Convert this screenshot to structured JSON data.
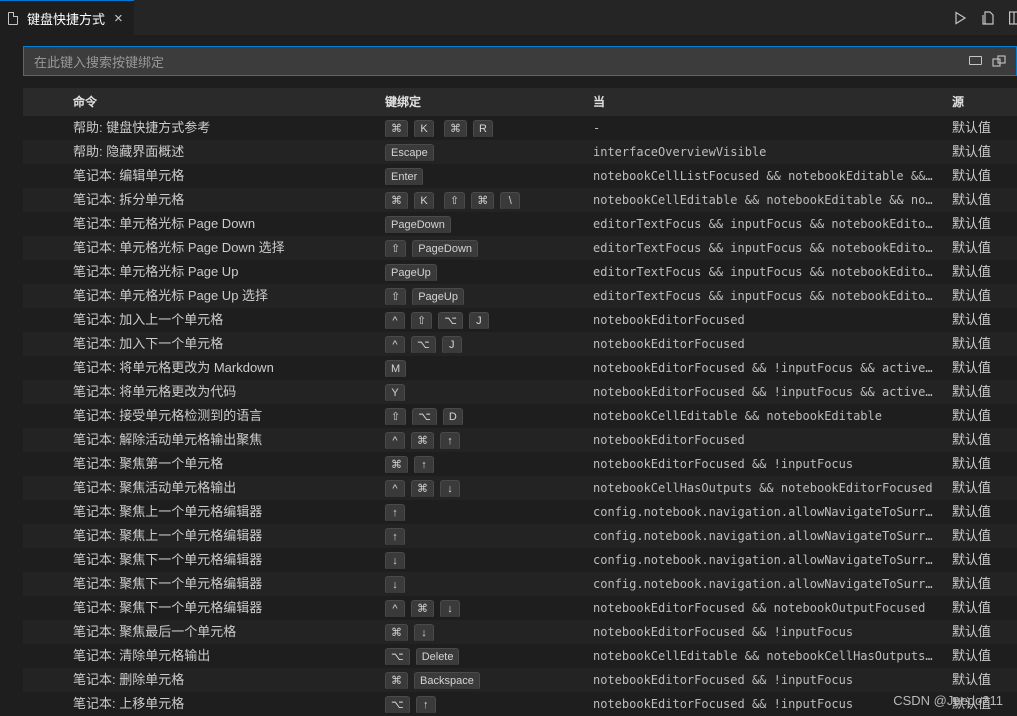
{
  "tab": {
    "title": "键盘快捷方式",
    "close": "×"
  },
  "search": {
    "placeholder": "在此键入搜索按键绑定"
  },
  "table": {
    "headers": {
      "command": "命令",
      "keybinding": "键绑定",
      "when": "当",
      "source": "源"
    },
    "rows": [
      {
        "command": "帮助: 键盘快捷方式参考",
        "keys": [
          [
            "⌘",
            "K"
          ],
          [
            "⌘",
            "R"
          ]
        ],
        "when": "-",
        "source": "默认值"
      },
      {
        "command": "帮助: 隐藏界面概述",
        "keys": [
          [
            "Escape"
          ]
        ],
        "when": "interfaceOverviewVisible",
        "source": "默认值"
      },
      {
        "command": "笔记本: 编辑单元格",
        "keys": [
          [
            "Enter"
          ]
        ],
        "when": "notebookCellListFocused && notebookEditable && !…",
        "source": "默认值"
      },
      {
        "command": "笔记本: 拆分单元格",
        "keys": [
          [
            "⌘",
            "K"
          ],
          [
            "⇧",
            "⌘",
            "\\"
          ]
        ],
        "when": "notebookCellEditable && notebookEditable && note…",
        "source": "默认值"
      },
      {
        "command": "笔记本: 单元格光标 Page Down",
        "keys": [
          [
            "PageDown"
          ]
        ],
        "when": "editorTextFocus && inputFocus && notebookEditorF…",
        "source": "默认值"
      },
      {
        "command": "笔记本: 单元格光标 Page Down 选择",
        "keys": [
          [
            "⇧",
            "PageDown"
          ]
        ],
        "when": "editorTextFocus && inputFocus && notebookEditorF…",
        "source": "默认值"
      },
      {
        "command": "笔记本: 单元格光标 Page Up",
        "keys": [
          [
            "PageUp"
          ]
        ],
        "when": "editorTextFocus && inputFocus && notebookEditorF…",
        "source": "默认值"
      },
      {
        "command": "笔记本: 单元格光标 Page Up 选择",
        "keys": [
          [
            "⇧",
            "PageUp"
          ]
        ],
        "when": "editorTextFocus && inputFocus && notebookEditorF…",
        "source": "默认值"
      },
      {
        "command": "笔记本: 加入上一个单元格",
        "keys": [
          [
            "^",
            "⇧",
            "⌥",
            "J"
          ]
        ],
        "when": "notebookEditorFocused",
        "source": "默认值"
      },
      {
        "command": "笔记本: 加入下一个单元格",
        "keys": [
          [
            "^",
            "⌥",
            "J"
          ]
        ],
        "when": "notebookEditorFocused",
        "source": "默认值"
      },
      {
        "command": "笔记本: 将单元格更改为 Markdown",
        "keys": [
          [
            "M"
          ]
        ],
        "when": "notebookEditorFocused && !inputFocus && activeEd…",
        "source": "默认值"
      },
      {
        "command": "笔记本: 将单元格更改为代码",
        "keys": [
          [
            "Y"
          ]
        ],
        "when": "notebookEditorFocused && !inputFocus && activeEd…",
        "source": "默认值"
      },
      {
        "command": "笔记本: 接受单元格检测到的语言",
        "keys": [
          [
            "⇧",
            "⌥",
            "D"
          ]
        ],
        "when": "notebookCellEditable && notebookEditable",
        "source": "默认值"
      },
      {
        "command": "笔记本: 解除活动单元格输出聚焦",
        "keys": [
          [
            "^",
            "⌘",
            "↑"
          ]
        ],
        "when": "notebookEditorFocused",
        "source": "默认值"
      },
      {
        "command": "笔记本: 聚焦第一个单元格",
        "keys": [
          [
            "⌘",
            "↑"
          ]
        ],
        "when": "notebookEditorFocused && !inputFocus",
        "source": "默认值"
      },
      {
        "command": "笔记本: 聚焦活动单元格输出",
        "keys": [
          [
            "^",
            "⌘",
            "↓"
          ]
        ],
        "when": "notebookCellHasOutputs && notebookEditorFocused",
        "source": "默认值"
      },
      {
        "command": "笔记本: 聚焦上一个单元格编辑器",
        "keys": [
          [
            "↑"
          ]
        ],
        "when": "config.notebook.navigation.allowNavigateToSurrou…",
        "source": "默认值"
      },
      {
        "command": "笔记本: 聚焦上一个单元格编辑器",
        "keys": [
          [
            "↑"
          ]
        ],
        "when": "config.notebook.navigation.allowNavigateToSurrou…",
        "source": "默认值"
      },
      {
        "command": "笔记本: 聚焦下一个单元格编辑器",
        "keys": [
          [
            "↓"
          ]
        ],
        "when": "config.notebook.navigation.allowNavigateToSurrou…",
        "source": "默认值"
      },
      {
        "command": "笔记本: 聚焦下一个单元格编辑器",
        "keys": [
          [
            "↓"
          ]
        ],
        "when": "config.notebook.navigation.allowNavigateToSurrou…",
        "source": "默认值"
      },
      {
        "command": "笔记本: 聚焦下一个单元格编辑器",
        "keys": [
          [
            "^",
            "⌘",
            "↓"
          ]
        ],
        "when": "notebookEditorFocused && notebookOutputFocused",
        "source": "默认值"
      },
      {
        "command": "笔记本: 聚焦最后一个单元格",
        "keys": [
          [
            "⌘",
            "↓"
          ]
        ],
        "when": "notebookEditorFocused && !inputFocus",
        "source": "默认值"
      },
      {
        "command": "笔记本: 清除单元格输出",
        "keys": [
          [
            "⌥",
            "Delete"
          ]
        ],
        "when": "notebookCellEditable && notebookCellHasOutputs &…",
        "source": "默认值"
      },
      {
        "command": "笔记本: 删除单元格",
        "keys": [
          [
            "⌘",
            "Backspace"
          ]
        ],
        "when": "notebookEditorFocused && !inputFocus",
        "source": "默认值"
      },
      {
        "command": "笔记本: 上移单元格",
        "keys": [
          [
            "⌥",
            "↑"
          ]
        ],
        "when": "notebookEditorFocused && !inputFocus",
        "source": "默认值"
      }
    ]
  },
  "watermark": "CSDN @Juedo211"
}
